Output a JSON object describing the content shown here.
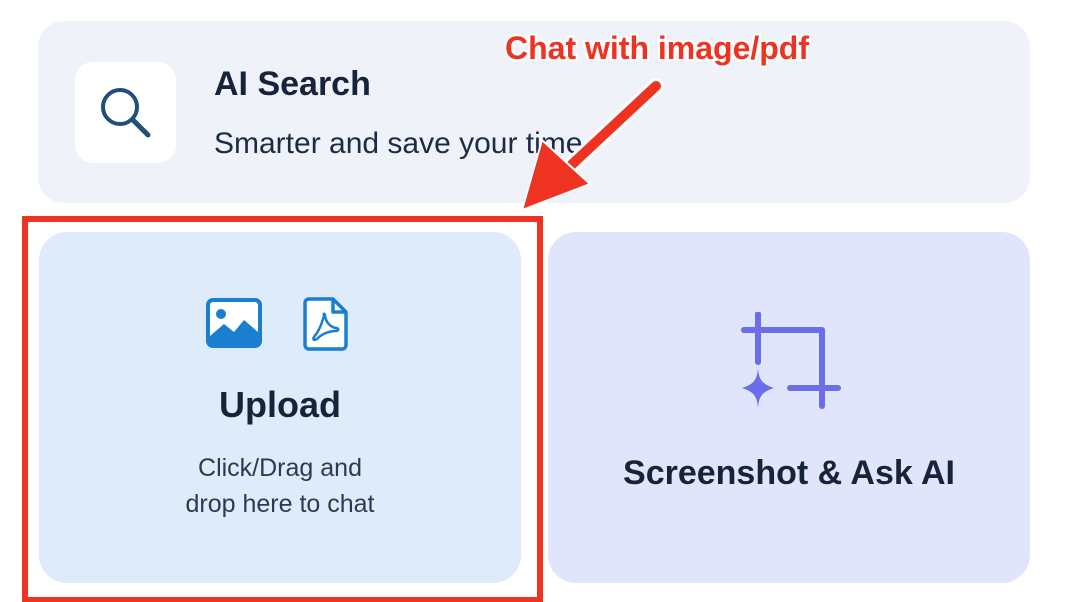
{
  "search_card": {
    "title": "AI Search",
    "subtitle": "Smarter and save your time",
    "icon": "search-icon"
  },
  "upload_card": {
    "title": "Upload",
    "description_line1": "Click/Drag and",
    "description_line2": "drop here to chat",
    "icons": [
      "image-icon",
      "pdf-file-icon"
    ]
  },
  "screenshot_card": {
    "title": "Screenshot & Ask AI",
    "icon": "crop-sparkle-icon"
  },
  "annotation": {
    "callout": "Chat with image/pdf",
    "color": "#ee3322"
  },
  "colors": {
    "icon_blue": "#1a7fd0",
    "search_icon": "#1f4f7a",
    "crop_purple": "#6a6ee8",
    "title_text": "#16233a"
  }
}
